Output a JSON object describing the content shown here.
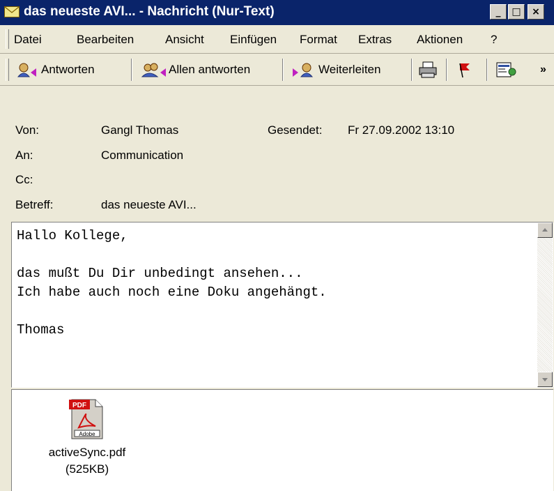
{
  "window": {
    "title": "das neueste AVI... - Nachricht (Nur-Text)",
    "buttons": {
      "minimize": "_",
      "maximize": "□",
      "close": "×"
    }
  },
  "menu": [
    "Datei",
    "Bearbeiten",
    "Ansicht",
    "Einfügen",
    "Format",
    "Extras",
    "Aktionen",
    "?"
  ],
  "toolbar": {
    "reply": "Antworten",
    "reply_all": "Allen antworten",
    "forward": "Weiterleiten",
    "overflow": "»"
  },
  "header": {
    "from_label": "Von:",
    "from_value": "Gangl Thomas",
    "sent_label": "Gesendet:",
    "sent_value": "Fr 27.09.2002 13:10",
    "to_label": "An:",
    "to_value": "Communication",
    "cc_label": "Cc:",
    "cc_value": "",
    "subject_label": "Betreff:",
    "subject_value": "das neueste AVI..."
  },
  "body": {
    "line1": "Hallo Kollege,",
    "line2": "",
    "line3": "das mußt Du Dir unbedingt ansehen...",
    "line4": "Ich habe auch noch eine Doku angehängt.",
    "line5": "",
    "line6": "Thomas"
  },
  "attachment": {
    "filename": "activeSync.pdf",
    "size": "(525KB)",
    "icon_badge": "PDF",
    "icon_brand": "Adobe"
  },
  "colors": {
    "titlebar": "#0a246a",
    "chrome": "#ece9d8",
    "pdf_red": "#d01010"
  }
}
